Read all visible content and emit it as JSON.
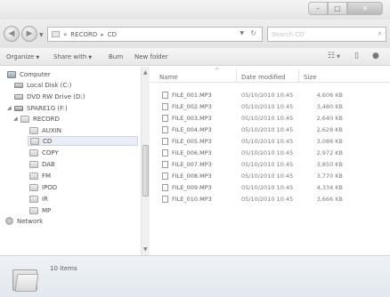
{
  "window": {
    "buttons": {
      "minimize": "–",
      "maximize": "□",
      "close": "✕"
    }
  },
  "address": {
    "root_sep": "«",
    "path": [
      "RECORD",
      "CD"
    ],
    "separator": "▸",
    "search_placeholder": "Search CD"
  },
  "toolbar": {
    "organize": "Organize",
    "share_with": "Share with",
    "burn": "Burn",
    "new_folder": "New folder"
  },
  "nav": {
    "items": [
      {
        "label": "Computer",
        "icon": "computer-icon"
      },
      {
        "label": "Local Disk (C:)",
        "icon": "disk-icon"
      },
      {
        "label": "DVD RW Drive (D:)",
        "icon": "dvd-drive-icon"
      },
      {
        "label": "SPARE1G (F:)",
        "icon": "removable-drive-icon"
      },
      {
        "label": "RECORD",
        "icon": "folder-icon"
      },
      {
        "label": "AUXIN",
        "icon": "folder-icon"
      },
      {
        "label": "CD",
        "icon": "folder-icon",
        "selected": true
      },
      {
        "label": "COPY",
        "icon": "folder-icon"
      },
      {
        "label": "DAB",
        "icon": "folder-icon"
      },
      {
        "label": "FM",
        "icon": "folder-icon"
      },
      {
        "label": "IPOD",
        "icon": "folder-icon"
      },
      {
        "label": "IR",
        "icon": "folder-icon"
      },
      {
        "label": "MP",
        "icon": "folder-icon"
      },
      {
        "label": "Network",
        "icon": "network-icon"
      }
    ]
  },
  "columns": {
    "name": "Name",
    "date": "Date modified",
    "size": "Size"
  },
  "files": [
    {
      "name": "FILE_001.MP3",
      "date": "05/10/2010 10:45",
      "size": "4,606 KB"
    },
    {
      "name": "FILE_002.MP3",
      "date": "05/10/2010 10:45",
      "size": "3,480 KB"
    },
    {
      "name": "FILE_003.MP3",
      "date": "05/10/2010 10:45",
      "size": "2,640 KB"
    },
    {
      "name": "FILE_004.MP3",
      "date": "05/10/2010 10:45",
      "size": "2,628 KB"
    },
    {
      "name": "FILE_005.MP3",
      "date": "05/10/2010 10:45",
      "size": "3,086 KB"
    },
    {
      "name": "FILE_006.MP3",
      "date": "05/10/2010 10:45",
      "size": "2,972 KB"
    },
    {
      "name": "FILE_007.MP3",
      "date": "05/10/2010 10:45",
      "size": "3,850 KB"
    },
    {
      "name": "FILE_008.MP3",
      "date": "05/10/2010 10:45",
      "size": "3,770 KB"
    },
    {
      "name": "FILE_009.MP3",
      "date": "05/10/2010 10:45",
      "size": "4,334 KB"
    },
    {
      "name": "FILE_010.MP3",
      "date": "05/10/2010 10:45",
      "size": "3,666 KB"
    }
  ],
  "status": {
    "count": "10 items"
  }
}
